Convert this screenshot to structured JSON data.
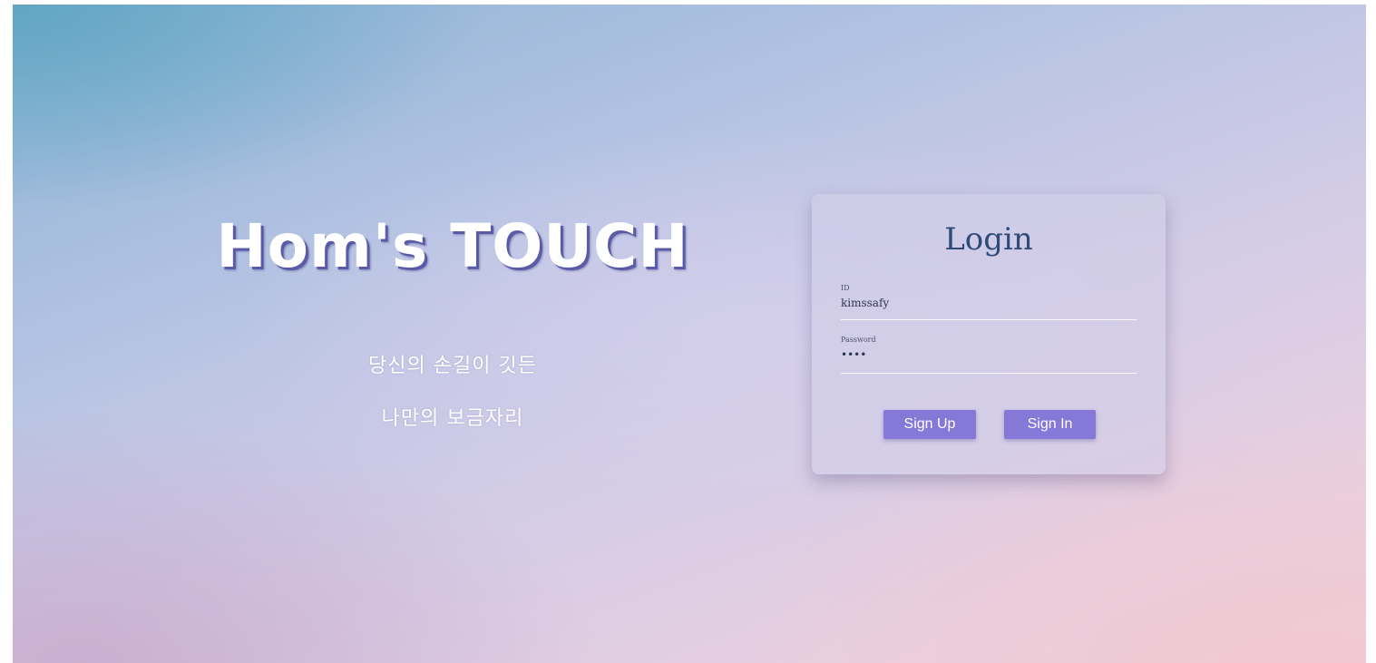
{
  "brand": {
    "title": "Hom's TOUCH",
    "subtitle_line1": "당신의 손길이 깃든",
    "subtitle_line2": "나만의 보금자리"
  },
  "login": {
    "title": "Login",
    "id_label": "ID",
    "id_value": "kimssafy",
    "password_label": "Password",
    "password_value": "••••",
    "signup_label": "Sign Up",
    "signin_label": "Sign In"
  },
  "colors": {
    "button": "#8578d6",
    "login_title": "#2e4a7a",
    "brand_shadow": "#5a5aa8"
  }
}
